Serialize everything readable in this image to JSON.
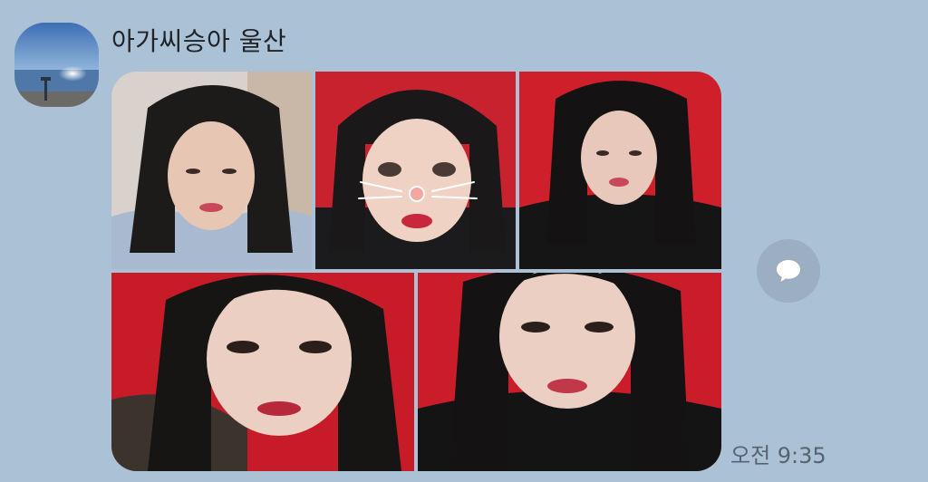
{
  "chat": {
    "sender_name": "아가씨승아 울산",
    "sent_time": "오전 9:35",
    "avatar_icon": "beach-sunset-avatar",
    "reply_icon": "speech-bubble-icon"
  },
  "photo_grid": {
    "photo_count": 5,
    "photos": [
      {
        "subject": "selfie",
        "background": "#d9d2cc"
      },
      {
        "subject": "selfie-cat-filter",
        "background": "#c9222f"
      },
      {
        "subject": "selfie",
        "background": "#cf1f2a"
      },
      {
        "subject": "selfie-closeup",
        "background": "#c71c27"
      },
      {
        "subject": "selfie-closeup",
        "background": "#cb1d29"
      }
    ]
  },
  "colors": {
    "chat_background": "#abc1d6",
    "reply_button": "#9cafc2"
  }
}
